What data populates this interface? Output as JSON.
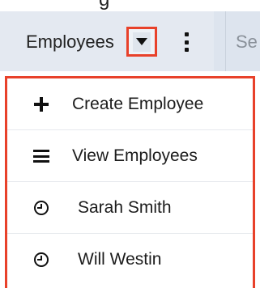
{
  "top_strip": {
    "partial_text": "g"
  },
  "nav": {
    "tab_label": "Employees",
    "next_tab_partial": "Se"
  },
  "dropdown": {
    "items": [
      {
        "label": "Create Employee",
        "icon": "plus-icon"
      },
      {
        "label": "View Employees",
        "icon": "list-icon"
      },
      {
        "label": "Sarah Smith",
        "icon": "clock-icon"
      },
      {
        "label": "Will Westin",
        "icon": "clock-icon"
      }
    ]
  },
  "colors": {
    "highlight_border": "#e8412a",
    "nav_background": "#e4e9f1",
    "text": "#222222",
    "muted_text": "#8a919a"
  }
}
